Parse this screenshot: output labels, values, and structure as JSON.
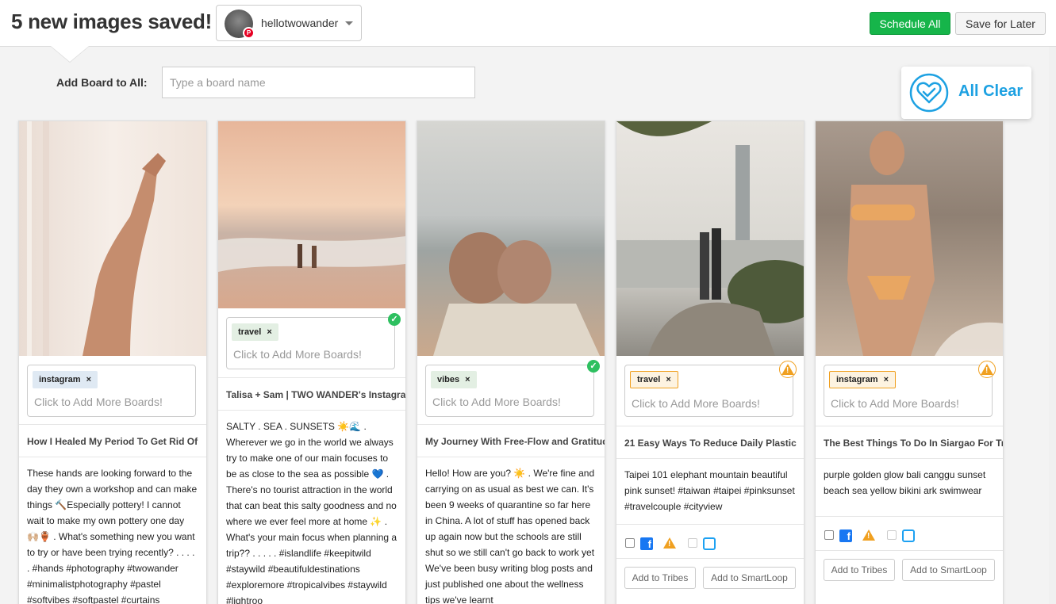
{
  "header": {
    "title": "5 new images saved!",
    "account_name": "hellotwowander",
    "schedule_all_label": "Schedule All",
    "save_later_label": "Save for Later"
  },
  "add_board": {
    "label": "Add Board to All:",
    "placeholder": "Type a board name"
  },
  "status": {
    "all_clear_label": "All Clear"
  },
  "common": {
    "add_more_placeholder": "Click to Add More Boards!",
    "add_to_tribes_label": "Add to Tribes",
    "add_to_smartloop_label": "Add to SmartLoop"
  },
  "cards": [
    {
      "board_tag": "instagram",
      "title": "How I Healed My Period To Get Rid Of",
      "description": "These hands are looking forward to the day they own a workshop and can make things 🔨Especially pottery! I cannot wait to make my own pottery one day 🙌🏼🏺 . What's something new you want to try or have been trying recently? . . . . . #hands #photography #twowander #minimalistphotography #pastel #softvibes #softpastel #curtains",
      "status": "none"
    },
    {
      "board_tag": "travel",
      "title": "Talisa + Sam  |  TWO WANDER's Instagram",
      "description": "SALTY . SEA . SUNSETS ☀️🌊 . Wherever we go in the world we always try to make one of our main focuses to be as close to the sea as possible 💙 . There's no tourist attraction in the world that can beat this salty goodness and no where we ever feel more at home ✨ . What's your main focus when planning a trip?? . . . . . #islandlife #keepitwild #staywild #beautifuldestinations #exploremore #tropicalvibes #staywild #lightroo",
      "status": "ok"
    },
    {
      "board_tag": "vibes",
      "title": "My Journey With Free-Flow and Gratitude",
      "description": "Hello! How are you? ☀️ . We're fine and carrying on as usual as best we can. It's been 9 weeks of quarantine so far here in China. A lot of stuff has opened back up again now but the schools are still shut so we still can't go back to work yet   We've been busy writing blog posts and just published one about the wellness tips we've learnt",
      "status": "ok"
    },
    {
      "board_tag": "travel",
      "title": "21 Easy Ways To Reduce Daily Plastic",
      "description": "Taipei 101 elephant mountain beautiful pink sunset! #taiwan #taipei #pinksunset #travelcouple #cityview",
      "status": "warn"
    },
    {
      "board_tag": "instagram",
      "title": "The Best Things To Do In Siargao For Travel",
      "description": "purple golden glow bali canggu sunset beach sea yellow bikini ark swimwear",
      "status": "warn"
    }
  ],
  "colors": {
    "primary_green": "#16b54a",
    "all_clear_blue": "#1da1e2",
    "warning_orange": "#f0a020",
    "facebook_blue": "#1877f2",
    "twitter_blue": "#1da1f2"
  }
}
